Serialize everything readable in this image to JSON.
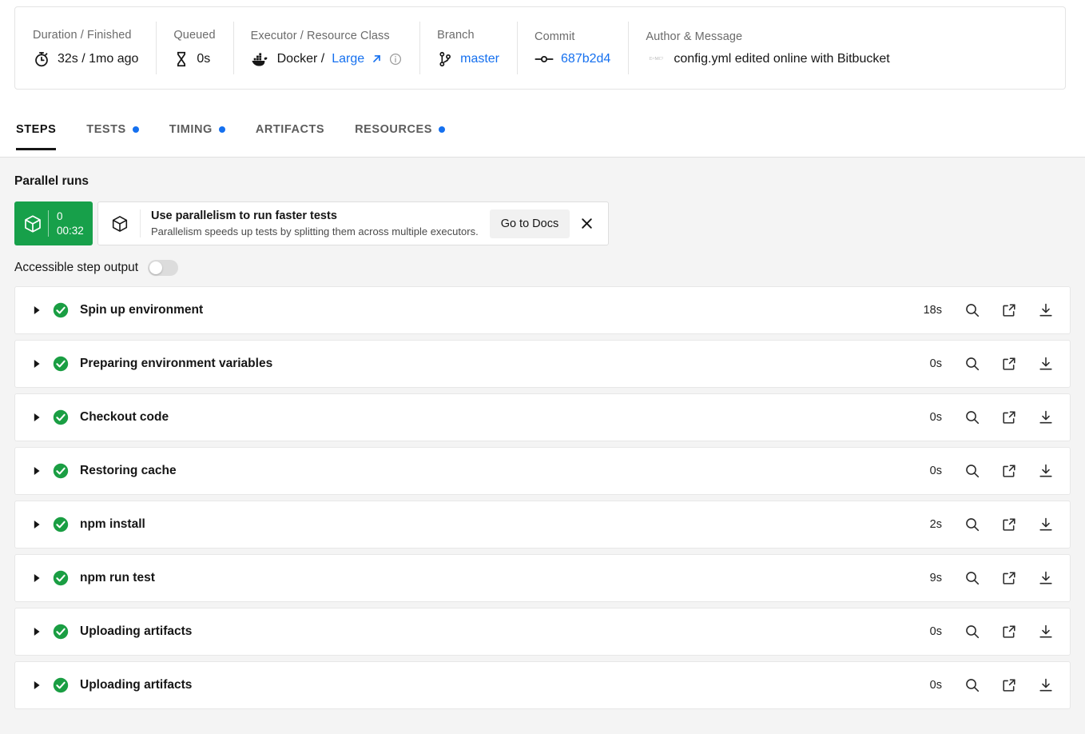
{
  "header": {
    "items": [
      {
        "label": "Duration / Finished",
        "icon": "stopwatch-icon",
        "value": "32s / 1mo ago",
        "name": "duration"
      },
      {
        "label": "Queued",
        "icon": "hourglass-icon",
        "value": "0s",
        "name": "queued"
      },
      {
        "label": "Executor / Resource Class",
        "icon": "docker-icon",
        "value": "Docker / ",
        "link": "Large",
        "name": "executor"
      },
      {
        "label": "Branch",
        "icon": "git-branch-icon",
        "link": "master",
        "name": "branch"
      },
      {
        "label": "Commit",
        "icon": "commit-icon",
        "link": "687b2d4",
        "name": "commit"
      },
      {
        "label": "Author & Message",
        "icon": "avatar",
        "avatar_text": "E=MC²",
        "value": "config.yml edited online with Bitbucket",
        "name": "author-message"
      }
    ]
  },
  "tabs": [
    {
      "label": "STEPS",
      "active": true,
      "dot": false
    },
    {
      "label": "TESTS",
      "active": false,
      "dot": true
    },
    {
      "label": "TIMING",
      "active": false,
      "dot": true
    },
    {
      "label": "ARTIFACTS",
      "active": false,
      "dot": false
    },
    {
      "label": "RESOURCES",
      "active": false,
      "dot": true
    }
  ],
  "main": {
    "section_title": "Parallel runs",
    "parallel_badge": {
      "index": "0",
      "time": "00:32",
      "color": "#17a04a"
    },
    "banner": {
      "title": "Use parallelism to run faster tests",
      "subtitle": "Parallelism speeds up tests by splitting them across multiple executors.",
      "button_label": "Go to Docs",
      "close_label": "×"
    },
    "accessible_toggle": {
      "label": "Accessible step output",
      "on": false
    },
    "steps": [
      {
        "name": "Spin up environment",
        "status": "success",
        "duration": "18s"
      },
      {
        "name": "Preparing environment variables",
        "status": "success",
        "duration": "0s"
      },
      {
        "name": "Checkout code",
        "status": "success",
        "duration": "0s"
      },
      {
        "name": "Restoring cache",
        "status": "success",
        "duration": "0s"
      },
      {
        "name": "npm install",
        "status": "success",
        "duration": "2s"
      },
      {
        "name": "npm run test",
        "status": "success",
        "duration": "9s"
      },
      {
        "name": "Uploading artifacts",
        "status": "success",
        "duration": "0s"
      },
      {
        "name": "Uploading artifacts",
        "status": "success",
        "duration": "0s"
      }
    ],
    "step_action_icons": [
      "search-icon",
      "external-link-icon",
      "download-icon"
    ]
  },
  "colors": {
    "accent_blue": "#1570ef",
    "success_green": "#17a04a",
    "page_bg": "#f4f4f4",
    "card_bg": "#ffffff"
  }
}
